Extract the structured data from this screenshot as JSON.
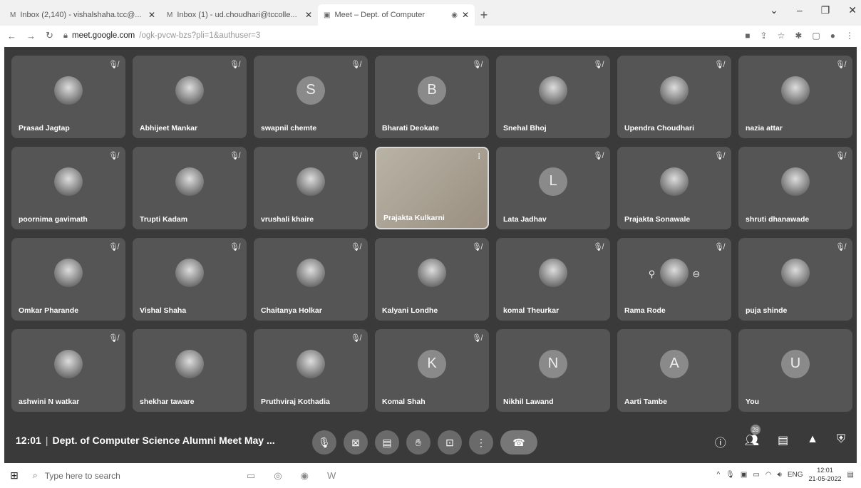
{
  "browser": {
    "tabs": [
      {
        "label": "Inbox (2,140) - vishalshaha.tcc@...",
        "icon": "gmail-icon",
        "active": false
      },
      {
        "label": "Inbox (1) - ud.choudhari@tccolle...",
        "icon": "gmail-icon",
        "active": false
      },
      {
        "label": "Meet – Dept. of Computer",
        "icon": "meet-icon",
        "active": true
      }
    ],
    "new_tab_label": "+",
    "url_host": "meet.google.com",
    "url_path": "/ogk-pvcw-bzs?pli=1&authuser=3"
  },
  "meeting": {
    "time": "12:01",
    "title": "Dept. of Computer Science Alumni Meet May ...",
    "participant_count": "28"
  },
  "participants": [
    {
      "name": "Prasad Jagtap",
      "avatar": "photo",
      "letter": "",
      "muted": true
    },
    {
      "name": "Abhijeet Mankar",
      "avatar": "photo",
      "letter": "",
      "muted": true
    },
    {
      "name": "swapnil chemte",
      "avatar": "letter",
      "letter": "S",
      "muted": true
    },
    {
      "name": "Bharati Deokate",
      "avatar": "letter",
      "letter": "B",
      "muted": true
    },
    {
      "name": "Snehal Bhoj",
      "avatar": "photo",
      "letter": "",
      "muted": true
    },
    {
      "name": "Upendra Choudhari",
      "avatar": "photo",
      "letter": "",
      "muted": true
    },
    {
      "name": "nazia attar",
      "avatar": "photo",
      "letter": "",
      "muted": true
    },
    {
      "name": "poornima gavimath",
      "avatar": "photo",
      "letter": "",
      "muted": true
    },
    {
      "name": "Trupti Kadam",
      "avatar": "photo",
      "letter": "",
      "muted": true
    },
    {
      "name": "vrushali khaire",
      "avatar": "photo",
      "letter": "",
      "muted": true
    },
    {
      "name": "Prajakta Kulkarni",
      "avatar": "video",
      "letter": "",
      "muted": false
    },
    {
      "name": "Lata Jadhav",
      "avatar": "letter",
      "letter": "L",
      "muted": true
    },
    {
      "name": "Prajakta Sonawale",
      "avatar": "photo",
      "letter": "",
      "muted": true
    },
    {
      "name": "shruti dhanawade",
      "avatar": "photo",
      "letter": "",
      "muted": true
    },
    {
      "name": "Omkar Pharande",
      "avatar": "photo",
      "letter": "",
      "muted": true
    },
    {
      "name": "Vishal Shaha",
      "avatar": "photo",
      "letter": "",
      "muted": true
    },
    {
      "name": "Chaitanya Holkar",
      "avatar": "photo",
      "letter": "",
      "muted": true
    },
    {
      "name": "Kalyani Londhe",
      "avatar": "photo",
      "letter": "",
      "muted": true
    },
    {
      "name": "komal Theurkar",
      "avatar": "photo",
      "letter": "",
      "muted": true
    },
    {
      "name": "Rama Rode",
      "avatar": "photo",
      "letter": "",
      "muted": true
    },
    {
      "name": "puja shinde",
      "avatar": "photo",
      "letter": "",
      "muted": true
    },
    {
      "name": "ashwini N watkar",
      "avatar": "photo",
      "letter": "",
      "muted": true
    },
    {
      "name": "shekhar taware",
      "avatar": "photo",
      "letter": "",
      "muted": false
    },
    {
      "name": "Pruthviraj Kothadia",
      "avatar": "photo",
      "letter": "",
      "muted": true
    },
    {
      "name": "Komal Shah",
      "avatar": "letter",
      "letter": "K",
      "muted": true
    },
    {
      "name": "Nikhil Lawand",
      "avatar": "letter",
      "letter": "N",
      "muted": false
    },
    {
      "name": "Aarti Tambe",
      "avatar": "letter",
      "letter": "A",
      "muted": false
    },
    {
      "name": "You",
      "avatar": "letter",
      "letter": "U",
      "muted": false
    }
  ],
  "taskbar": {
    "search_placeholder": "Type here to search",
    "lang": "ENG",
    "time": "12:01",
    "date": "21-05-2022"
  },
  "colors": {
    "stage_bg": "#3a3a3a",
    "tile_bg": "#555555",
    "end_call": "#777777"
  }
}
